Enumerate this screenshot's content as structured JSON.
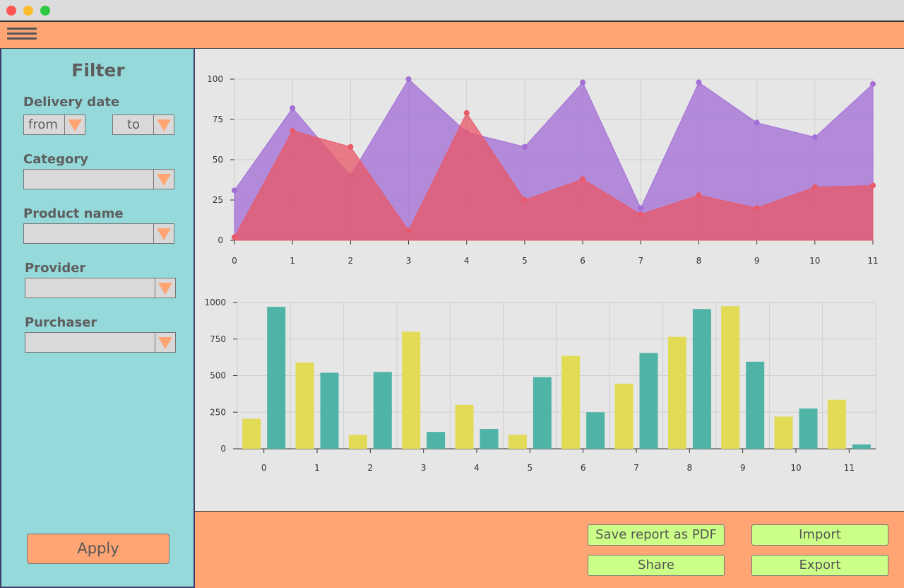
{
  "sidebar": {
    "title": "Filter",
    "delivery_date_label": "Delivery date",
    "from_value": "from",
    "to_value": "to",
    "category_label": "Category",
    "product_name_label": "Product name",
    "provider_label": "Provider",
    "purchaser_label": "Purchaser",
    "apply_label": "Apply"
  },
  "actions": {
    "save_pdf": "Save report as PDF",
    "import": "Import",
    "share": "Share",
    "export": "Export"
  },
  "colors": {
    "accent": "#ffa574",
    "sidebar_bg": "#95d9da",
    "button_bg": "#ccff88",
    "series_purple": "#a46fd6",
    "series_red": "#e85a6a",
    "bar_yellow": "#e2db55",
    "bar_teal": "#4fb3a6"
  },
  "icons": {
    "menu": "hamburger-icon",
    "dropdown": "triangle-down-icon"
  },
  "chart_data": [
    {
      "type": "area",
      "x": [
        0,
        1,
        2,
        3,
        4,
        5,
        6,
        7,
        8,
        9,
        10,
        11
      ],
      "ylim": [
        0,
        100
      ],
      "yticks": [
        0,
        25,
        50,
        75,
        100
      ],
      "grid": true,
      "series": [
        {
          "values": [
            31,
            82,
            40,
            100,
            67,
            58,
            98,
            20,
            98,
            73,
            64,
            97
          ],
          "color": "#a46fd6"
        },
        {
          "values": [
            2,
            68,
            58,
            6,
            79,
            25,
            38,
            16,
            28,
            20,
            33,
            34
          ],
          "color": "#e85a6a"
        }
      ]
    },
    {
      "type": "bar",
      "categories": [
        "0",
        "1",
        "2",
        "3",
        "4",
        "5",
        "6",
        "7",
        "8",
        "9",
        "10",
        "11"
      ],
      "ylim": [
        0,
        1000
      ],
      "yticks": [
        0,
        250,
        500,
        750,
        1000
      ],
      "grid": true,
      "series": [
        {
          "values": [
            205,
            590,
            95,
            800,
            300,
            95,
            635,
            445,
            765,
            975,
            220,
            335
          ],
          "color": "#e2db55"
        },
        {
          "values": [
            970,
            520,
            525,
            115,
            135,
            490,
            250,
            655,
            955,
            595,
            275,
            30
          ],
          "color": "#4fb3a6"
        }
      ]
    }
  ]
}
